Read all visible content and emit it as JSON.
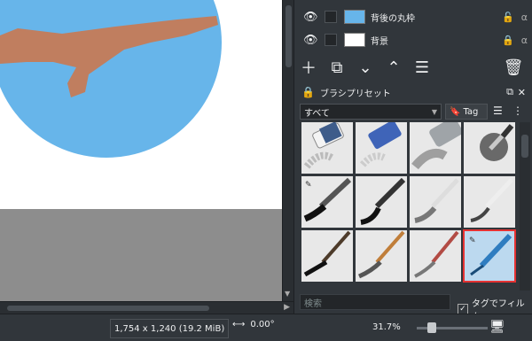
{
  "layers": [
    {
      "name": "背後の丸枠",
      "lock": "🔓",
      "alpha": "α"
    },
    {
      "name": "背景",
      "lock": "🔒",
      "alpha": "α"
    }
  ],
  "brush_presets": {
    "title": "ブラシプリセット",
    "filter_combo": "すべて",
    "tag_button": "Tag",
    "search_placeholder": "検索",
    "filter_checkbox_label": "タグでフィルタ",
    "filter_checked": true,
    "brushes": [
      {
        "name": "eraser"
      },
      {
        "name": "blue-eraser"
      },
      {
        "name": "airbrush"
      },
      {
        "name": "pen-blur"
      },
      {
        "name": "marker-bold"
      },
      {
        "name": "ink-pen"
      },
      {
        "name": "pencil-soft"
      },
      {
        "name": "pencil-hard"
      },
      {
        "name": "brush-ink"
      },
      {
        "name": "brush-wet"
      },
      {
        "name": "brush-dry"
      },
      {
        "name": "pencil-blue",
        "selected": true
      }
    ]
  },
  "status": {
    "image_size": "1,754 x 1,240 (19.2 MiB)",
    "rotation": "0.00°",
    "zoom": "31.7%"
  },
  "colors": {
    "sky": "#67b5ea",
    "arm": "#c07e5f",
    "accent_select": "#e63232"
  }
}
